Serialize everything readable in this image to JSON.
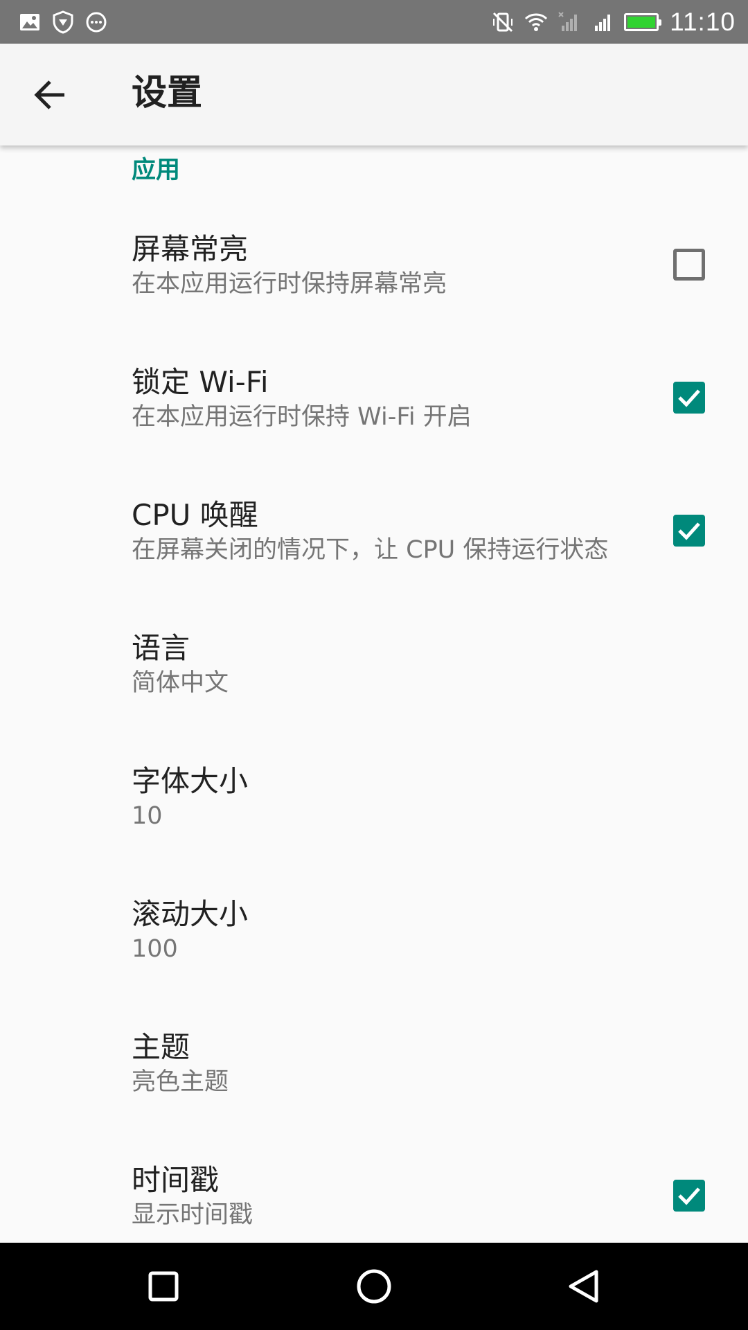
{
  "status_bar": {
    "time": "11:10",
    "left_icons": [
      "image-icon",
      "shield-icon",
      "chat-bubble-icon"
    ],
    "right_icons": [
      "vibrate-off-icon",
      "wifi-icon",
      "signal-sim2-icon",
      "signal-sim1-icon",
      "battery-icon"
    ],
    "battery_level": 1.0,
    "battery_color": "#31d331"
  },
  "app_bar": {
    "title": "设置",
    "back_icon": "arrow-back-icon"
  },
  "category": {
    "title": "应用",
    "color": "#00897b"
  },
  "preferences": [
    {
      "title": "屏幕常亮",
      "summary": "在本应用运行时保持屏幕常亮",
      "has_checkbox": true,
      "checked": false
    },
    {
      "title": "锁定 Wi-Fi",
      "summary": "在本应用运行时保持 Wi-Fi 开启",
      "has_checkbox": true,
      "checked": true
    },
    {
      "title": "CPU 唤醒",
      "summary": "在屏幕关闭的情况下，让 CPU 保持运行状态",
      "has_checkbox": true,
      "checked": true
    },
    {
      "title": "语言",
      "summary": "简体中文",
      "has_checkbox": false
    },
    {
      "title": "字体大小",
      "summary": "10",
      "has_checkbox": false
    },
    {
      "title": "滚动大小",
      "summary": "100",
      "has_checkbox": false
    },
    {
      "title": "主题",
      "summary": "亮色主题",
      "has_checkbox": false
    },
    {
      "title": "时间戳",
      "summary": "显示时间戳",
      "has_checkbox": true,
      "checked": true
    }
  ],
  "nav_bar": {
    "buttons": [
      "recents-square-icon",
      "home-circle-icon",
      "back-triangle-icon"
    ]
  },
  "colors": {
    "accent": "#00897b",
    "status_bar": "#757575",
    "app_bar": "#f5f5f5",
    "background": "#fafafa"
  }
}
